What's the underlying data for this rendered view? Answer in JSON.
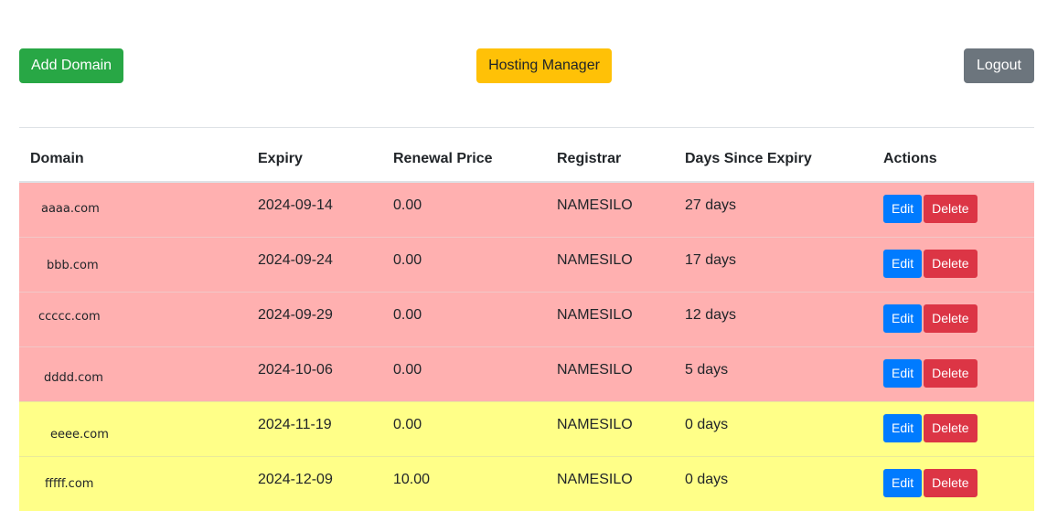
{
  "toolbar": {
    "add_label": "Add Domain",
    "hosting_label": "Hosting Manager",
    "logout_label": "Logout"
  },
  "colors": {
    "add": "#28a745",
    "hosting": "#ffc107",
    "logout": "#6c757d",
    "edit": "#007bff",
    "delete": "#dc3545",
    "expired_row": "#ffb0b0",
    "warning_row": "#ffff88"
  },
  "table": {
    "headers": [
      "Domain",
      "Expiry",
      "Renewal Price",
      "Registrar",
      "Days Since Expiry",
      "Actions"
    ],
    "rows": [
      {
        "domain": "aaaa.com",
        "expiry": "2024-09-14",
        "price": "0.00",
        "registrar": "NAMESILO",
        "days": "27 days",
        "status": "expired",
        "edit": "Edit",
        "delete": "Delete"
      },
      {
        "domain": "bbb.com",
        "expiry": "2024-09-24",
        "price": "0.00",
        "registrar": "NAMESILO",
        "days": "17 days",
        "status": "expired",
        "edit": "Edit",
        "delete": "Delete"
      },
      {
        "domain": "ccccc.com",
        "expiry": "2024-09-29",
        "price": "0.00",
        "registrar": "NAMESILO",
        "days": "12 days",
        "status": "expired",
        "edit": "Edit",
        "delete": "Delete"
      },
      {
        "domain": "dddd.com",
        "expiry": "2024-10-06",
        "price": "0.00",
        "registrar": "NAMESILO",
        "days": "5 days",
        "status": "expired",
        "edit": "Edit",
        "delete": "Delete"
      },
      {
        "domain": "eeee.com",
        "expiry": "2024-11-19",
        "price": "0.00",
        "registrar": "NAMESILO",
        "days": "0 days",
        "status": "warning",
        "edit": "Edit",
        "delete": "Delete"
      },
      {
        "domain": "fffff.com",
        "expiry": "2024-12-09",
        "price": "10.00",
        "registrar": "NAMESILO",
        "days": "0 days",
        "status": "warning",
        "edit": "Edit",
        "delete": "Delete"
      }
    ]
  }
}
